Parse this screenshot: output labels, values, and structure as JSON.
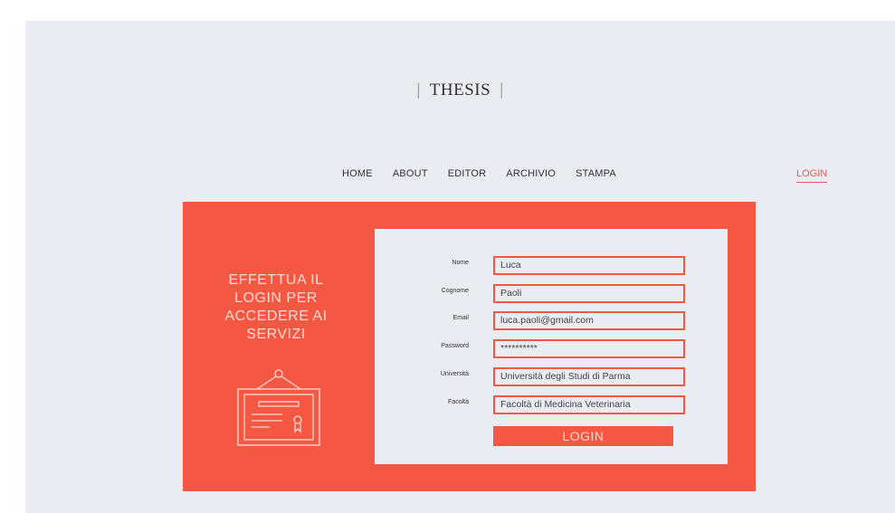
{
  "brand": {
    "title": "THESIS",
    "divider": "|"
  },
  "nav": {
    "items": [
      "HOME",
      "ABOUT",
      "EDITOR",
      "ARCHIVIO",
      "STAMPA"
    ],
    "login": "LOGIN"
  },
  "hero": {
    "message": "EFFETTUA IL LOGIN PER ACCEDERE AI SERVIZI",
    "icon": "certificate-icon"
  },
  "form": {
    "fields": [
      {
        "label": "Nome",
        "value": "Luca"
      },
      {
        "label": "Cognome",
        "value": "Paoli"
      },
      {
        "label": "Email",
        "value": "luca.paoli@gmail.com"
      },
      {
        "label": "Password",
        "value": "**********"
      },
      {
        "label": "Università",
        "value": "Università degli Studi di Parma"
      },
      {
        "label": "Facoltà",
        "value": "Facoltà di Medicina Veterinaria"
      }
    ],
    "submit": "LOGIN"
  },
  "colors": {
    "accent": "#f45843",
    "background": "#e9ecf2",
    "text": "#333333"
  }
}
